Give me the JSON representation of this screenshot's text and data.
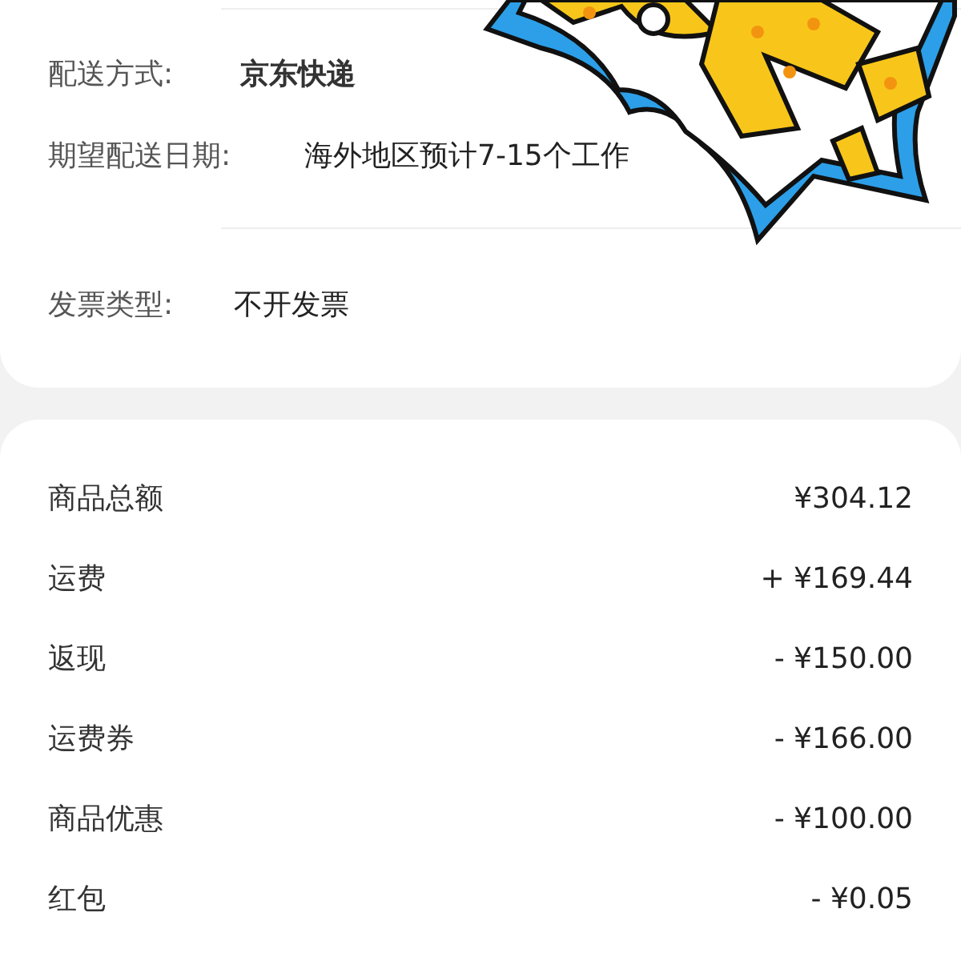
{
  "delivery": [
    {
      "label": "配送方式:",
      "value": "京东快递",
      "kind": "bold"
    },
    {
      "label": "期望配送日期:",
      "value": "海外地区预计7-15个工作",
      "kind": "normal"
    }
  ],
  "invoice": {
    "label": "发票类型:",
    "value": "不开发票"
  },
  "summary": [
    {
      "label": "商品总额",
      "value": "¥304.12"
    },
    {
      "label": "运费",
      "value": "+ ¥169.44"
    },
    {
      "label": "返现",
      "value": "- ¥150.00"
    },
    {
      "label": "运费券",
      "value": "- ¥166.00"
    },
    {
      "label": "商品优惠",
      "value": "- ¥100.00"
    },
    {
      "label": "红包",
      "value": "- ¥0.05"
    }
  ]
}
